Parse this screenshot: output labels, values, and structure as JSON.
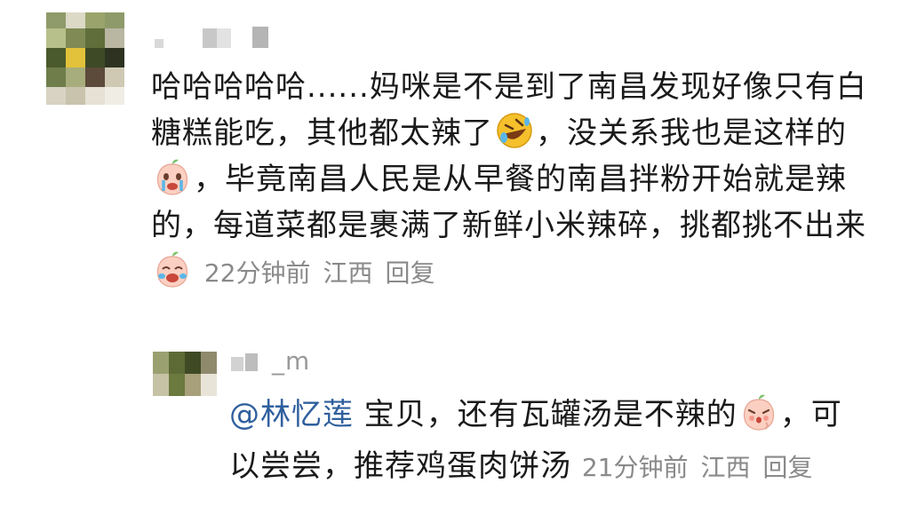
{
  "comment": {
    "text_part1": "哈哈哈哈哈......妈咪是不是到了南昌发现好像只有白糖糕能吃，其他都太辣了",
    "text_part2": "，没关系我也是这样的",
    "text_part3": "，毕竟南昌人民是从早餐的南昌拌粉开始就是辣的，每道菜都是裹满了新鲜小米辣碎，挑都挑不出来",
    "time": "22分钟前",
    "location": "江西",
    "reply_label": "回复",
    "emoji_1": "rofl-emoji",
    "emoji_2": "crying-peach-emoji",
    "emoji_3": "crying-peach-emoji"
  },
  "reply": {
    "username_visible": "_m",
    "mention": "@林忆莲",
    "text_part1": " 宝贝，还有瓦罐汤是不辣的",
    "text_part2": "，可以尝尝，推荐鸡蛋肉饼汤",
    "time": "21分钟前",
    "location": "江西",
    "reply_label": "回复",
    "emoji_1": "shy-peach-emoji"
  }
}
